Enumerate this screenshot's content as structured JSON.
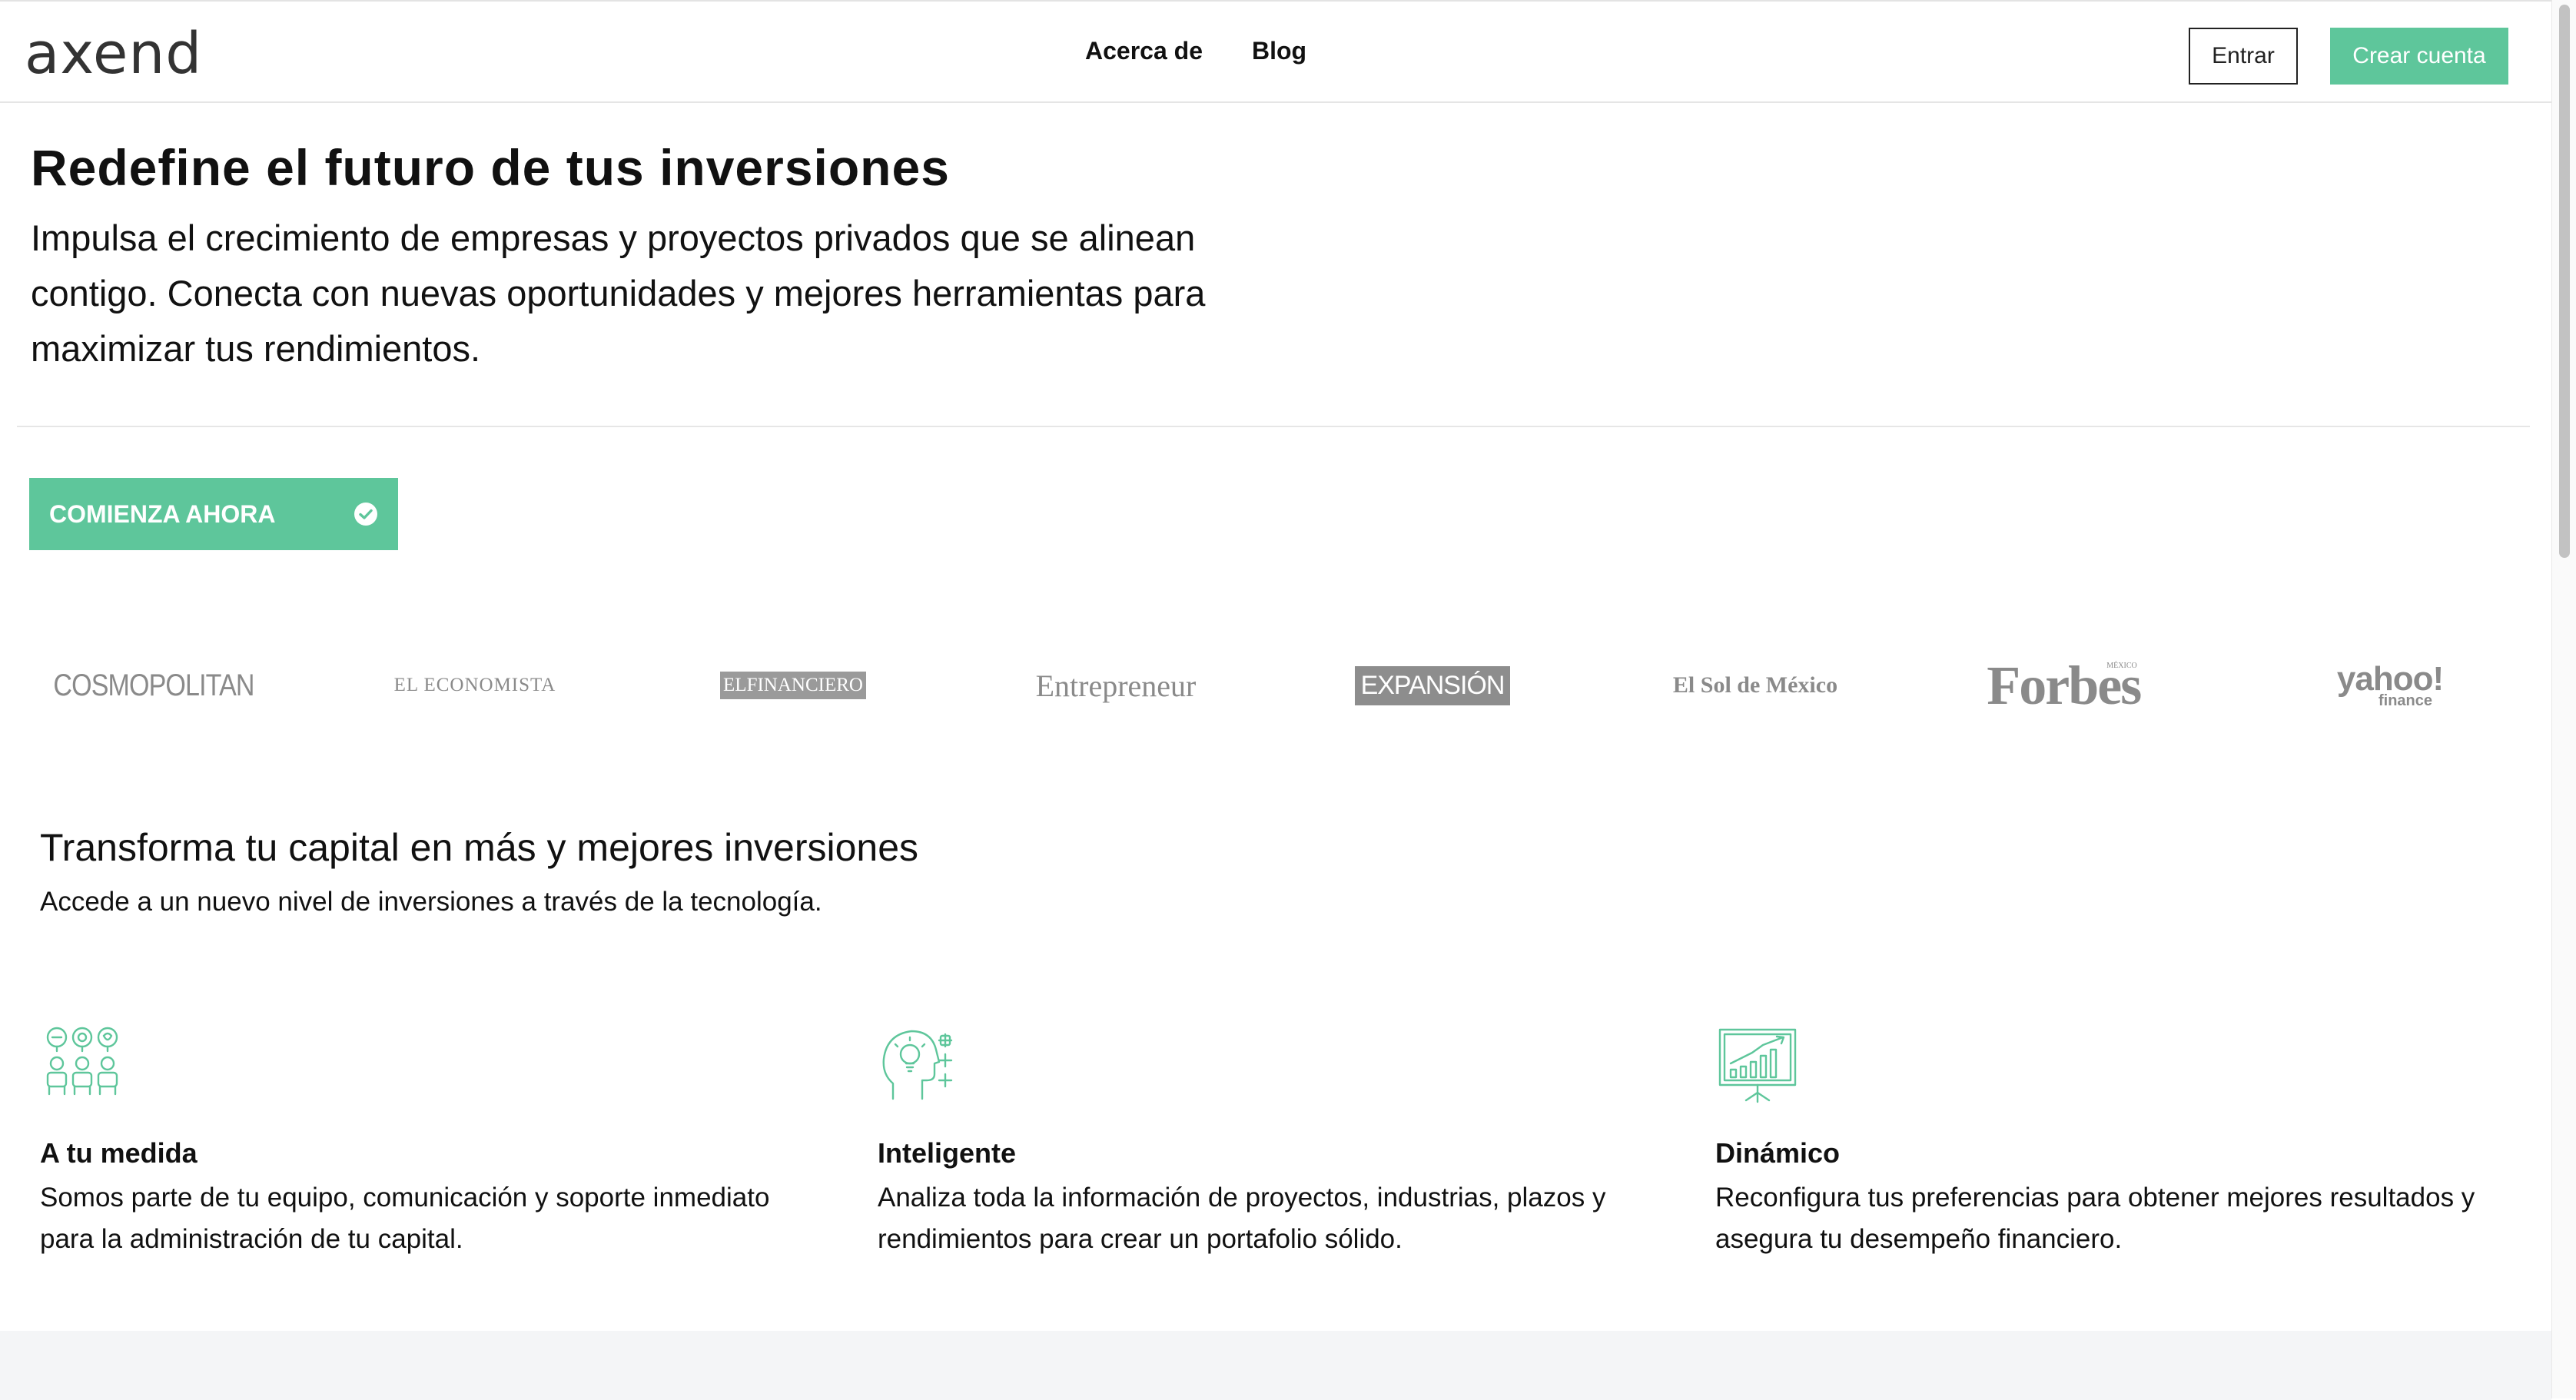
{
  "header": {
    "logo_text": "axend",
    "nav": [
      {
        "label": "Acerca de"
      },
      {
        "label": "Blog"
      }
    ],
    "login_label": "Entrar",
    "signup_label": "Crear cuenta"
  },
  "hero": {
    "title": "Redefine el futuro de tus inversiones",
    "subtitle": "Impulsa el crecimiento de empresas y proyectos privados que se alinean contigo. Conecta con nuevas oportunidades y mejores herramientas para maximizar tus rendimientos.",
    "cta_label": "COMIENZA AHORA",
    "cta_icon": "check-circle-icon"
  },
  "press": {
    "cosmopolitan": "COSMOPOLITAN",
    "el_economista": "EL ECONOMISTA",
    "el_financiero": "ELFINANCIERO",
    "entrepreneur": "Entrepreneur",
    "expansion": "EXPANSIÓN",
    "el_sol": "El Sol de México",
    "forbes": "Forbes",
    "forbes_small": "MÉXICO",
    "yahoo": "yahoo!",
    "yahoo_sub": "finance"
  },
  "section": {
    "title": "Transforma tu capital en más y mejores inversiones",
    "subtitle": "Accede a un nuevo nivel de inversiones a través de la tecnología."
  },
  "features": [
    {
      "icon": "team-support-icon",
      "title": "A tu medida",
      "text": "Somos parte de tu equipo, comunicación y soporte inmediato para la administración de tu capital."
    },
    {
      "icon": "smart-head-icon",
      "title": "Inteligente",
      "text": "Analiza toda la información de proyectos, industrias, plazos y rendimientos para crear un portafolio sólido."
    },
    {
      "icon": "growth-chart-icon",
      "title": "Dinámico",
      "text": "Reconfigura tus preferencias para obtener mejores resultados y asegura tu desempeño financiero."
    }
  ],
  "colors": {
    "accent": "#5ec69b",
    "text": "#111111",
    "border": "#e5e5e5"
  }
}
